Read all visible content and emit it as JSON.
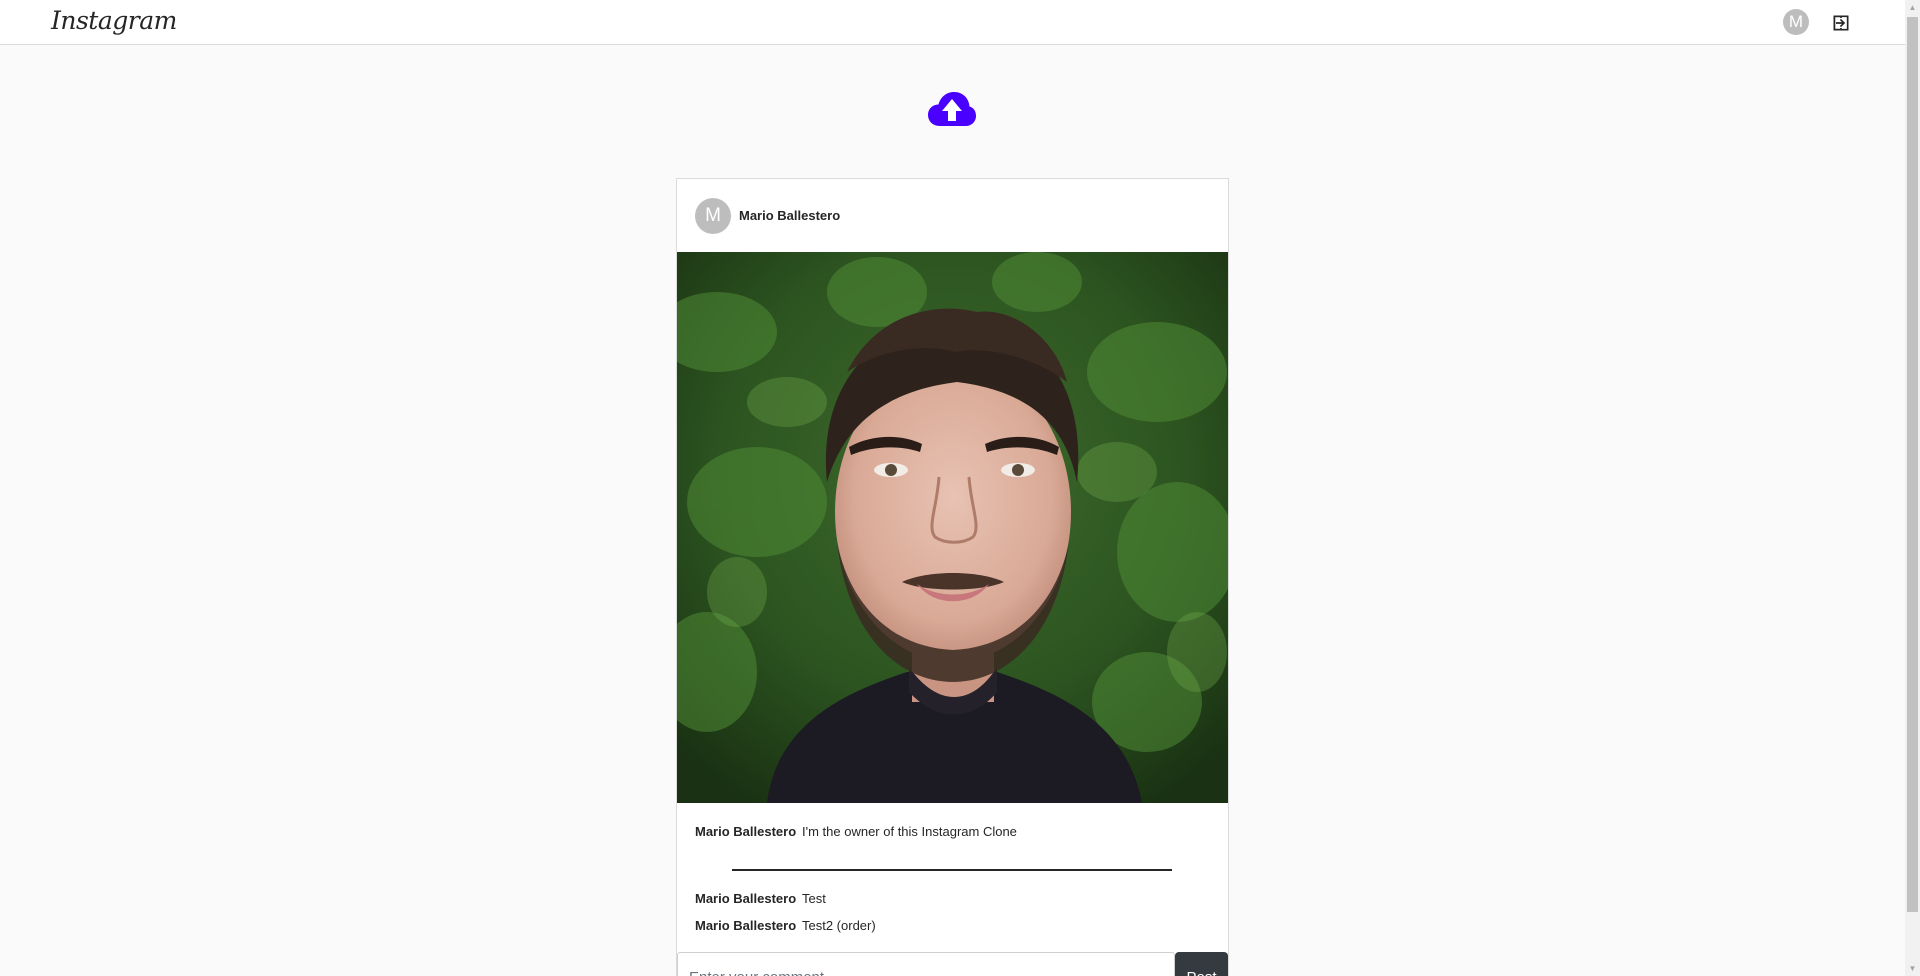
{
  "navbar": {
    "logo_text": "Instagram",
    "avatar_initial": "M",
    "logout_icon": "logout-icon"
  },
  "upload": {
    "icon": "cloud-upload-icon",
    "color": "#4a00ff"
  },
  "post": {
    "avatar_initial": "M",
    "username": "Mario Ballestero",
    "image_alt": "selfie of a bearded young man in a black t-shirt in front of green conifer hedge",
    "caption": {
      "username": "Mario Ballestero",
      "text": "I'm the owner of this Instagram Clone"
    },
    "comments": [
      {
        "username": "Mario Ballestero",
        "text": "Test"
      },
      {
        "username": "Mario Ballestero",
        "text": "Test2 (order)"
      }
    ],
    "comment_form": {
      "placeholder": "Enter your comment ...",
      "value": "",
      "submit_label": "Post"
    }
  },
  "colors": {
    "page_background": "#fafafa",
    "post_button": "#343a40",
    "avatar": "#bdbdbd"
  }
}
